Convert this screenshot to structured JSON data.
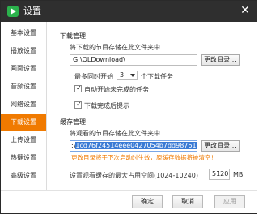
{
  "window": {
    "title": "设置"
  },
  "sidebar": {
    "items": [
      {
        "label": "基本设置"
      },
      {
        "label": "播放设置"
      },
      {
        "label": "画面设置"
      },
      {
        "label": "音频设置"
      },
      {
        "label": "网络设置"
      },
      {
        "label": "下载设置"
      },
      {
        "label": "上传设置"
      },
      {
        "label": "热键设置"
      },
      {
        "label": "高级设置"
      }
    ],
    "active_index": 5
  },
  "download": {
    "section_title": "下载管理",
    "dir_label": "将下载的节目存储在此文件夹中",
    "dir_value": "G:\\QLDownload\\",
    "change_dir_button": "更改目录...",
    "max_tasks_prefix": "最多同时开始",
    "max_tasks_value": "3",
    "max_tasks_suffix": "个下载任务",
    "auto_start_label": "自动开始未完成的任务",
    "auto_start_checked": true,
    "complete_prompt_label": "下载完成后提示",
    "complete_prompt_checked": true
  },
  "cache": {
    "section_title": "缓存管理",
    "dir_label": "将观看的节目存储在此文件夹中",
    "dir_prefix": ":\\",
    "dir_selected": "1cd76f24514eee0427054b7dd9876192",
    "change_dir_button": "更改目录...",
    "warning": "更改目录将于下次启动时生效，原缓存数据将被清空！",
    "max_space_label": "设置观看缓存的最大占用空间(1024-10240)",
    "max_space_value": "5120",
    "max_space_unit": "MB"
  },
  "footer": {
    "ok": "确定",
    "cancel": "取消",
    "apply": "应用"
  },
  "colors": {
    "accent": "#f07a00",
    "titlebar": "#2f2f2f",
    "selection": "#3a7bd5"
  }
}
